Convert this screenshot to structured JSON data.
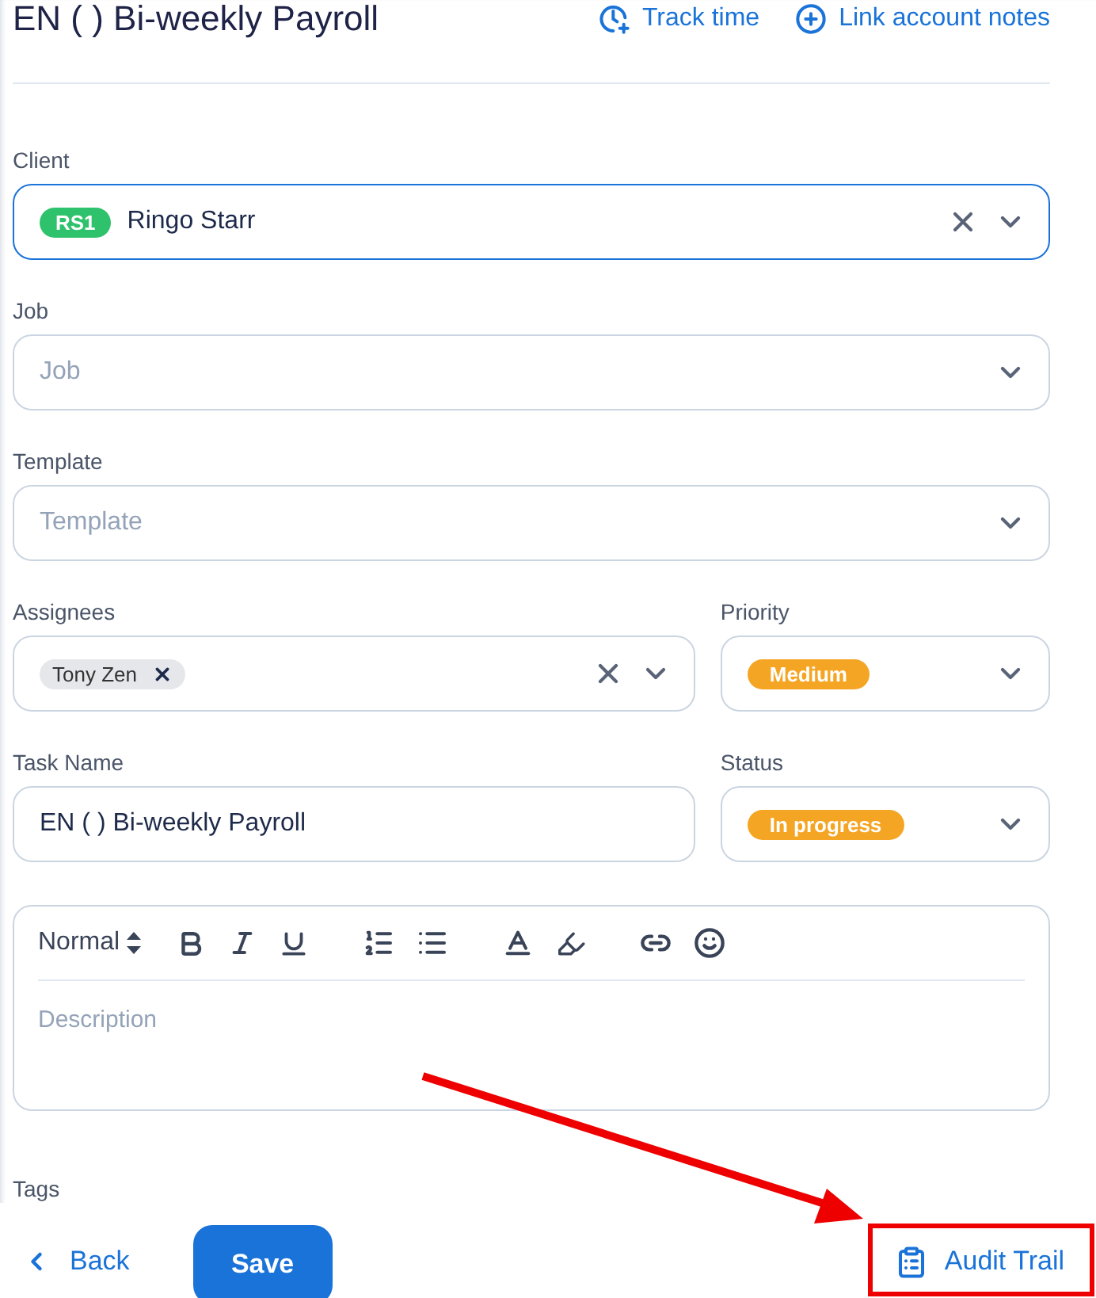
{
  "title": "EN ( ) Bi-weekly Payroll",
  "header_actions": [
    {
      "kind": "track",
      "label": "Track time"
    },
    {
      "kind": "link",
      "label": "Link account notes"
    }
  ],
  "client": {
    "label": "Client",
    "badge": "RS1",
    "value": "Ringo Starr"
  },
  "job": {
    "label": "Job",
    "placeholder": "Job"
  },
  "template": {
    "label": "Template",
    "placeholder": "Template"
  },
  "assignees": {
    "label": "Assignees",
    "chips": [
      {
        "label": "Tony Zen"
      }
    ]
  },
  "priority": {
    "label": "Priority",
    "value": "Medium"
  },
  "task_name": {
    "label": "Task Name",
    "value": "EN ( ) Bi-weekly Payroll"
  },
  "status": {
    "label": "Status",
    "value": "In progress"
  },
  "editor": {
    "style": "Normal",
    "placeholder": "Description"
  },
  "tags_label": "Tags",
  "footer": {
    "back": "Back",
    "save": "Save",
    "audit": "Audit Trail",
    "highlighted": true
  }
}
